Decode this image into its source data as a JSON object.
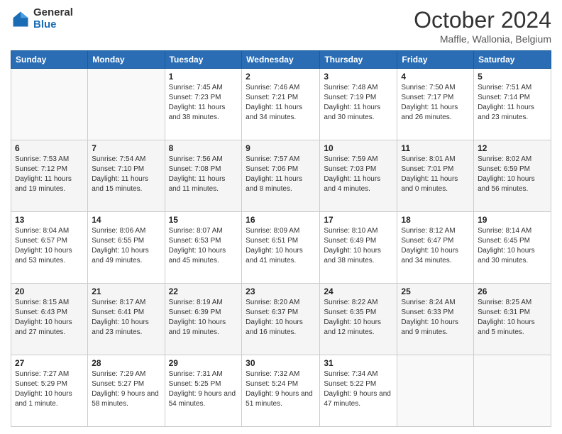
{
  "logo": {
    "general": "General",
    "blue": "Blue"
  },
  "header": {
    "month": "October 2024",
    "location": "Maffle, Wallonia, Belgium"
  },
  "weekdays": [
    "Sunday",
    "Monday",
    "Tuesday",
    "Wednesday",
    "Thursday",
    "Friday",
    "Saturday"
  ],
  "weeks": [
    [
      null,
      null,
      {
        "day": "1",
        "sunrise": "Sunrise: 7:45 AM",
        "sunset": "Sunset: 7:23 PM",
        "daylight": "Daylight: 11 hours and 38 minutes."
      },
      {
        "day": "2",
        "sunrise": "Sunrise: 7:46 AM",
        "sunset": "Sunset: 7:21 PM",
        "daylight": "Daylight: 11 hours and 34 minutes."
      },
      {
        "day": "3",
        "sunrise": "Sunrise: 7:48 AM",
        "sunset": "Sunset: 7:19 PM",
        "daylight": "Daylight: 11 hours and 30 minutes."
      },
      {
        "day": "4",
        "sunrise": "Sunrise: 7:50 AM",
        "sunset": "Sunset: 7:17 PM",
        "daylight": "Daylight: 11 hours and 26 minutes."
      },
      {
        "day": "5",
        "sunrise": "Sunrise: 7:51 AM",
        "sunset": "Sunset: 7:14 PM",
        "daylight": "Daylight: 11 hours and 23 minutes."
      }
    ],
    [
      {
        "day": "6",
        "sunrise": "Sunrise: 7:53 AM",
        "sunset": "Sunset: 7:12 PM",
        "daylight": "Daylight: 11 hours and 19 minutes."
      },
      {
        "day": "7",
        "sunrise": "Sunrise: 7:54 AM",
        "sunset": "Sunset: 7:10 PM",
        "daylight": "Daylight: 11 hours and 15 minutes."
      },
      {
        "day": "8",
        "sunrise": "Sunrise: 7:56 AM",
        "sunset": "Sunset: 7:08 PM",
        "daylight": "Daylight: 11 hours and 11 minutes."
      },
      {
        "day": "9",
        "sunrise": "Sunrise: 7:57 AM",
        "sunset": "Sunset: 7:06 PM",
        "daylight": "Daylight: 11 hours and 8 minutes."
      },
      {
        "day": "10",
        "sunrise": "Sunrise: 7:59 AM",
        "sunset": "Sunset: 7:03 PM",
        "daylight": "Daylight: 11 hours and 4 minutes."
      },
      {
        "day": "11",
        "sunrise": "Sunrise: 8:01 AM",
        "sunset": "Sunset: 7:01 PM",
        "daylight": "Daylight: 11 hours and 0 minutes."
      },
      {
        "day": "12",
        "sunrise": "Sunrise: 8:02 AM",
        "sunset": "Sunset: 6:59 PM",
        "daylight": "Daylight: 10 hours and 56 minutes."
      }
    ],
    [
      {
        "day": "13",
        "sunrise": "Sunrise: 8:04 AM",
        "sunset": "Sunset: 6:57 PM",
        "daylight": "Daylight: 10 hours and 53 minutes."
      },
      {
        "day": "14",
        "sunrise": "Sunrise: 8:06 AM",
        "sunset": "Sunset: 6:55 PM",
        "daylight": "Daylight: 10 hours and 49 minutes."
      },
      {
        "day": "15",
        "sunrise": "Sunrise: 8:07 AM",
        "sunset": "Sunset: 6:53 PM",
        "daylight": "Daylight: 10 hours and 45 minutes."
      },
      {
        "day": "16",
        "sunrise": "Sunrise: 8:09 AM",
        "sunset": "Sunset: 6:51 PM",
        "daylight": "Daylight: 10 hours and 41 minutes."
      },
      {
        "day": "17",
        "sunrise": "Sunrise: 8:10 AM",
        "sunset": "Sunset: 6:49 PM",
        "daylight": "Daylight: 10 hours and 38 minutes."
      },
      {
        "day": "18",
        "sunrise": "Sunrise: 8:12 AM",
        "sunset": "Sunset: 6:47 PM",
        "daylight": "Daylight: 10 hours and 34 minutes."
      },
      {
        "day": "19",
        "sunrise": "Sunrise: 8:14 AM",
        "sunset": "Sunset: 6:45 PM",
        "daylight": "Daylight: 10 hours and 30 minutes."
      }
    ],
    [
      {
        "day": "20",
        "sunrise": "Sunrise: 8:15 AM",
        "sunset": "Sunset: 6:43 PM",
        "daylight": "Daylight: 10 hours and 27 minutes."
      },
      {
        "day": "21",
        "sunrise": "Sunrise: 8:17 AM",
        "sunset": "Sunset: 6:41 PM",
        "daylight": "Daylight: 10 hours and 23 minutes."
      },
      {
        "day": "22",
        "sunrise": "Sunrise: 8:19 AM",
        "sunset": "Sunset: 6:39 PM",
        "daylight": "Daylight: 10 hours and 19 minutes."
      },
      {
        "day": "23",
        "sunrise": "Sunrise: 8:20 AM",
        "sunset": "Sunset: 6:37 PM",
        "daylight": "Daylight: 10 hours and 16 minutes."
      },
      {
        "day": "24",
        "sunrise": "Sunrise: 8:22 AM",
        "sunset": "Sunset: 6:35 PM",
        "daylight": "Daylight: 10 hours and 12 minutes."
      },
      {
        "day": "25",
        "sunrise": "Sunrise: 8:24 AM",
        "sunset": "Sunset: 6:33 PM",
        "daylight": "Daylight: 10 hours and 9 minutes."
      },
      {
        "day": "26",
        "sunrise": "Sunrise: 8:25 AM",
        "sunset": "Sunset: 6:31 PM",
        "daylight": "Daylight: 10 hours and 5 minutes."
      }
    ],
    [
      {
        "day": "27",
        "sunrise": "Sunrise: 7:27 AM",
        "sunset": "Sunset: 5:29 PM",
        "daylight": "Daylight: 10 hours and 1 minute."
      },
      {
        "day": "28",
        "sunrise": "Sunrise: 7:29 AM",
        "sunset": "Sunset: 5:27 PM",
        "daylight": "Daylight: 9 hours and 58 minutes."
      },
      {
        "day": "29",
        "sunrise": "Sunrise: 7:31 AM",
        "sunset": "Sunset: 5:25 PM",
        "daylight": "Daylight: 9 hours and 54 minutes."
      },
      {
        "day": "30",
        "sunrise": "Sunrise: 7:32 AM",
        "sunset": "Sunset: 5:24 PM",
        "daylight": "Daylight: 9 hours and 51 minutes."
      },
      {
        "day": "31",
        "sunrise": "Sunrise: 7:34 AM",
        "sunset": "Sunset: 5:22 PM",
        "daylight": "Daylight: 9 hours and 47 minutes."
      },
      null,
      null
    ]
  ]
}
